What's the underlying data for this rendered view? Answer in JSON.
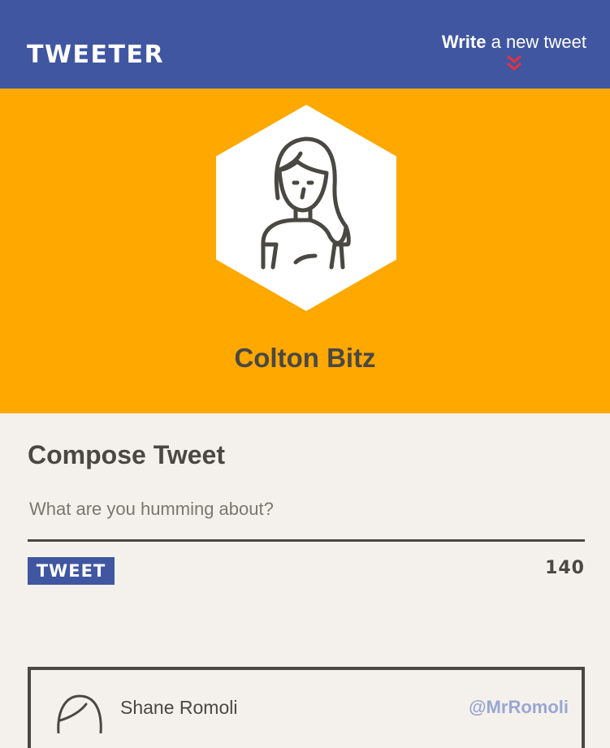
{
  "nav": {
    "brand": "TWEETER",
    "write_bold": "Write",
    "write_rest": " a new tweet"
  },
  "profile": {
    "name": "Colton Bitz"
  },
  "compose": {
    "title": "Compose Tweet",
    "placeholder": "What are you humming about?",
    "button_label": "TWEET",
    "counter": "140"
  },
  "tweets": [
    {
      "author": "Shane Romoli",
      "handle": "@MrRomoli"
    }
  ],
  "colors": {
    "nav_bg": "#4056a1",
    "header_bg": "#ffa800",
    "page_bg": "#f4f1ec",
    "text": "#4a4843",
    "chevron": "#e8323c",
    "handle": "#9aa7d2"
  },
  "icons": {
    "write_chevron": "double-chevron-down-icon",
    "profile_avatar": "avatar-woman-icon",
    "tweet_avatar": "avatar-icon"
  }
}
